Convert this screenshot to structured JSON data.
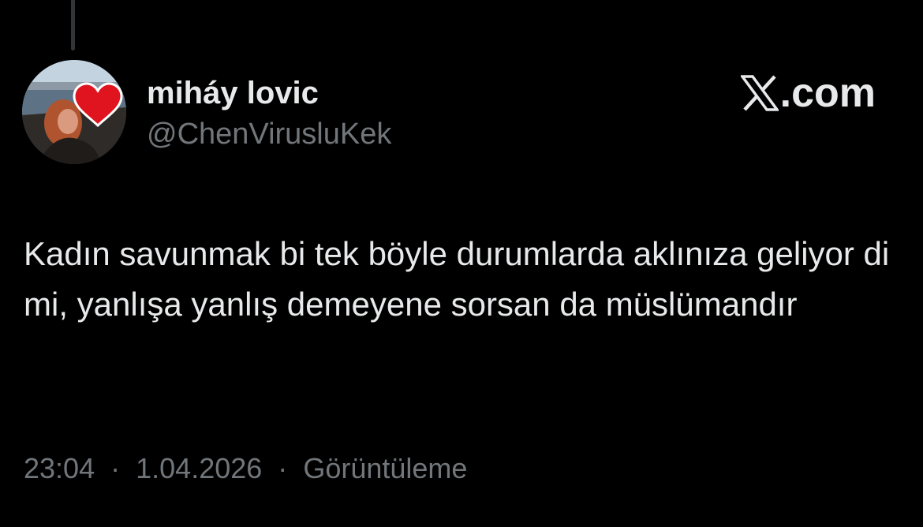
{
  "tweet": {
    "display_name": "miháy lovic",
    "handle": "@ChenVirusluKek",
    "text": "Kadın savunmak bi tek böyle durumlarda aklınıza geliyor di mi, yanlışa yanlış demeyene sorsan da müslümandır",
    "time": "23:04",
    "date": "1.04.2026",
    "views_label": "Görüntüleme",
    "separator": "·"
  },
  "brand": {
    "icon": "x-logo-icon",
    "suffix": ".com"
  },
  "avatar": {
    "icon": "heart-icon",
    "heart_color": "#e0141e"
  },
  "colors": {
    "background": "#000000",
    "primary_text": "#e7e9ea",
    "secondary_text": "#71767b"
  }
}
